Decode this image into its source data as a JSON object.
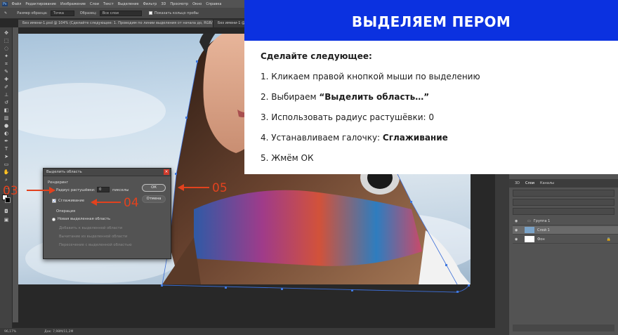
{
  "menubar": {
    "items": [
      "Файл",
      "Редактирование",
      "Изображение",
      "Слои",
      "Текст",
      "Выделение",
      "Фильтр",
      "3D",
      "Просмотр",
      "Окно",
      "Справка"
    ]
  },
  "options_bar": {
    "size_label": "Размер образца:",
    "size_value": "Точка",
    "sample_label": "Образец:",
    "sample_value": "Все слои",
    "ring_label": "Показать кольцо пробы"
  },
  "tabs": [
    {
      "label": "Без имени-1.psd @ 104% (Сделайте следующее: 1. Проводим по линии выделения от начала до, RGB/8#) *",
      "active": true
    },
    {
      "label": "Без имени-1 @",
      "active": false
    }
  ],
  "overlay": {
    "banner_title": "ВЫДЕЛЯЕМ ПЕРОМ",
    "heading": "Сделайте следующее:",
    "step1": "1. Кликаем правой кнопкой мыши по выделению",
    "step2_prefix": "2. Выбираем ",
    "step2_bold": "“Выделить область…”",
    "step3": "3. Использовать радиус растушёвки: 0",
    "step4_prefix": "4. Устанавливаем галочку: ",
    "step4_bold": "Сглаживание",
    "step5": "5. Жмём ОК"
  },
  "dialog": {
    "title": "Выделить область",
    "rendering_label": "Рендеринг",
    "radius_label": "Радиус растушёвки:",
    "radius_value": "0",
    "radius_unit": "пикселы",
    "antialias_label": "Сглаживание",
    "antialias_checked": true,
    "operation_label": "Операция",
    "op_new": "Новая выделенная область",
    "op_add": "Добавить к выделенной области",
    "op_subtract": "Вычитание из выделенной области",
    "op_intersect": "Пересечение с выделенной областью",
    "ok_label": "ОК",
    "cancel_label": "Отмена"
  },
  "callouts": {
    "c03": "03",
    "c04": "04",
    "c05": "05",
    "color": "#e2421e"
  },
  "layers_panel": {
    "tabs": [
      "3D",
      "Слои",
      "Каналы"
    ],
    "layers": [
      {
        "name": "Группа 1"
      },
      {
        "name": "Слой 1"
      },
      {
        "name": "Фон"
      }
    ]
  },
  "statusbar": {
    "zoom": "96,17%",
    "doc": "Док: 7,98М/11,2М"
  },
  "colors": {
    "banner": "#0b31e0",
    "callout": "#e2421e"
  }
}
